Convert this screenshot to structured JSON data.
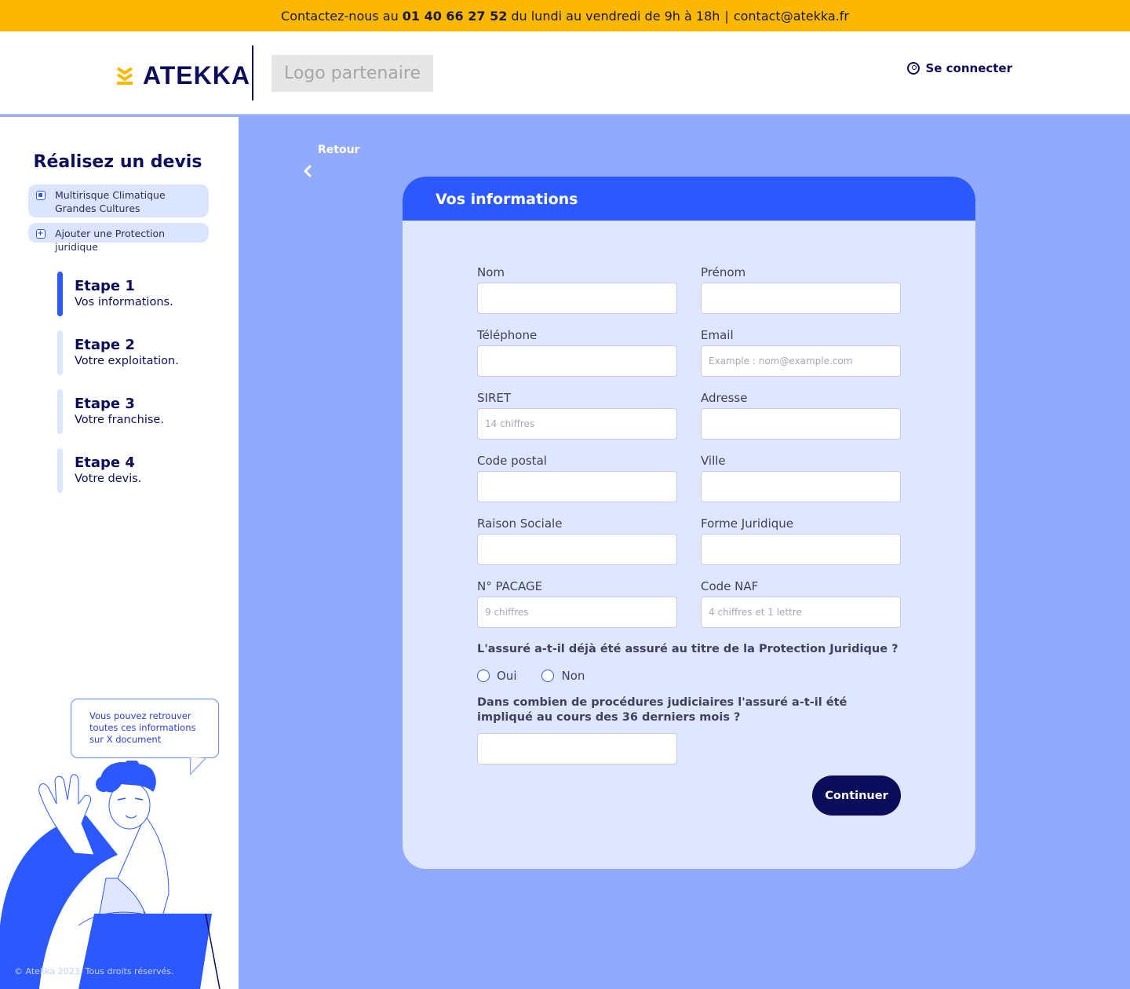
{
  "topbar": {
    "prefix": "Contactez-nous au",
    "phone": "01 40 66 27 52",
    "hours": "du lundi au vendredi de 9h à 18h",
    "separator": "|",
    "email": "contact@atekka.fr"
  },
  "header": {
    "brand": "ATEKKA",
    "partner_logo": "Logo partenaire",
    "login_label": "Se connecter"
  },
  "sidebar": {
    "title": "Réalisez un devis",
    "products": [
      {
        "label": "Multirisque Climatique Grandes Cultures",
        "checked": true
      },
      {
        "label": "Ajouter une Protection juridique",
        "checked": false
      }
    ],
    "steps": [
      {
        "title": "Etape 1",
        "desc": "Vos informations.",
        "active": true
      },
      {
        "title": "Etape 2",
        "desc": "Votre exploitation.",
        "active": false
      },
      {
        "title": "Etape 3",
        "desc": "Votre franchise.",
        "active": false
      },
      {
        "title": "Etape 4",
        "desc": "Votre devis.",
        "active": false
      }
    ],
    "help_bubble": "Vous pouvez retrouver toutes ces informations sur X document",
    "copyright": "© Atekka 2023. Tous droits réservés."
  },
  "back_label": "Retour",
  "form": {
    "title": "Vos informations",
    "fields": {
      "nom": {
        "label": "Nom",
        "value": "",
        "placeholder": ""
      },
      "prenom": {
        "label": "Prénom",
        "value": "",
        "placeholder": ""
      },
      "telephone": {
        "label": "Téléphone",
        "value": "",
        "placeholder": ""
      },
      "email": {
        "label": "Email",
        "value": "",
        "placeholder": "Example : nom@example.com"
      },
      "siret": {
        "label": "SIRET",
        "value": "",
        "placeholder": "14 chiffres"
      },
      "adresse": {
        "label": "Adresse",
        "value": "",
        "placeholder": ""
      },
      "code_postal": {
        "label": "Code postal",
        "value": "",
        "placeholder": ""
      },
      "ville": {
        "label": "Ville",
        "value": "",
        "placeholder": ""
      },
      "raison_sociale": {
        "label": "Raison Sociale",
        "value": "",
        "placeholder": ""
      },
      "forme_juridique": {
        "label": "Forme Juridique",
        "value": "",
        "placeholder": ""
      },
      "pacage": {
        "label": "N° PACAGE",
        "value": "",
        "placeholder": "9 chiffres"
      },
      "code_naf": {
        "label": "Code NAF",
        "value": "",
        "placeholder": "4 chiffres et 1 lettre"
      },
      "procedures": {
        "label": "",
        "value": "",
        "placeholder": ""
      }
    },
    "question_pj": "L'assuré a-t-il déjà été assuré au titre de la Protection Juridique ?",
    "radio_yes": "Oui",
    "radio_no": "Non",
    "question_procedures": "Dans combien de procédures judiciaires l'assuré a-t-il été impliqué au cours des 36 derniers mois ?",
    "submit_label": "Continuer"
  },
  "colors": {
    "primary": "#2b59ff",
    "navy": "#0c0d5a",
    "yellow": "#fcb800",
    "page_bg": "#92aafe",
    "card_bg": "#dfe6ff"
  }
}
